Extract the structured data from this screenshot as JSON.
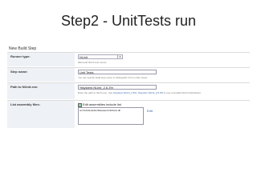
{
  "slide": {
    "title": "Step2 - UnitTests run"
  },
  "screen": {
    "page_title": "New Build Step",
    "runner_type": {
      "label": "Runner type:",
      "value": "NUnit",
      "hint": "Microsoft NUnit test runner"
    },
    "step_name": {
      "label": "Step name:",
      "value": "Unit Tests",
      "hint": "You can specify build step name to distinguish it from other steps."
    },
    "path_to_nunit": {
      "label": "Path to NUnit.exe:",
      "value": "%system.NUnit_2.6.3%",
      "hint_prefix": "Enter the path to NUnit.exe. Use",
      "hint_link1": "%system.NUnit_2.6%",
      "hint_sep": ", ",
      "hint_link2": "%system.NUnit_2.6.3%",
      "hint_suffix": " to use a bundled NUnit distribution."
    },
    "list_assembly_files": {
      "label": "List assembly files:",
      "edit_label": "Edit assemblies include list",
      "value": "src\\UnitTests\\bin\\Release\\UnitTests.dll",
      "edit_link": "Edit"
    }
  }
}
